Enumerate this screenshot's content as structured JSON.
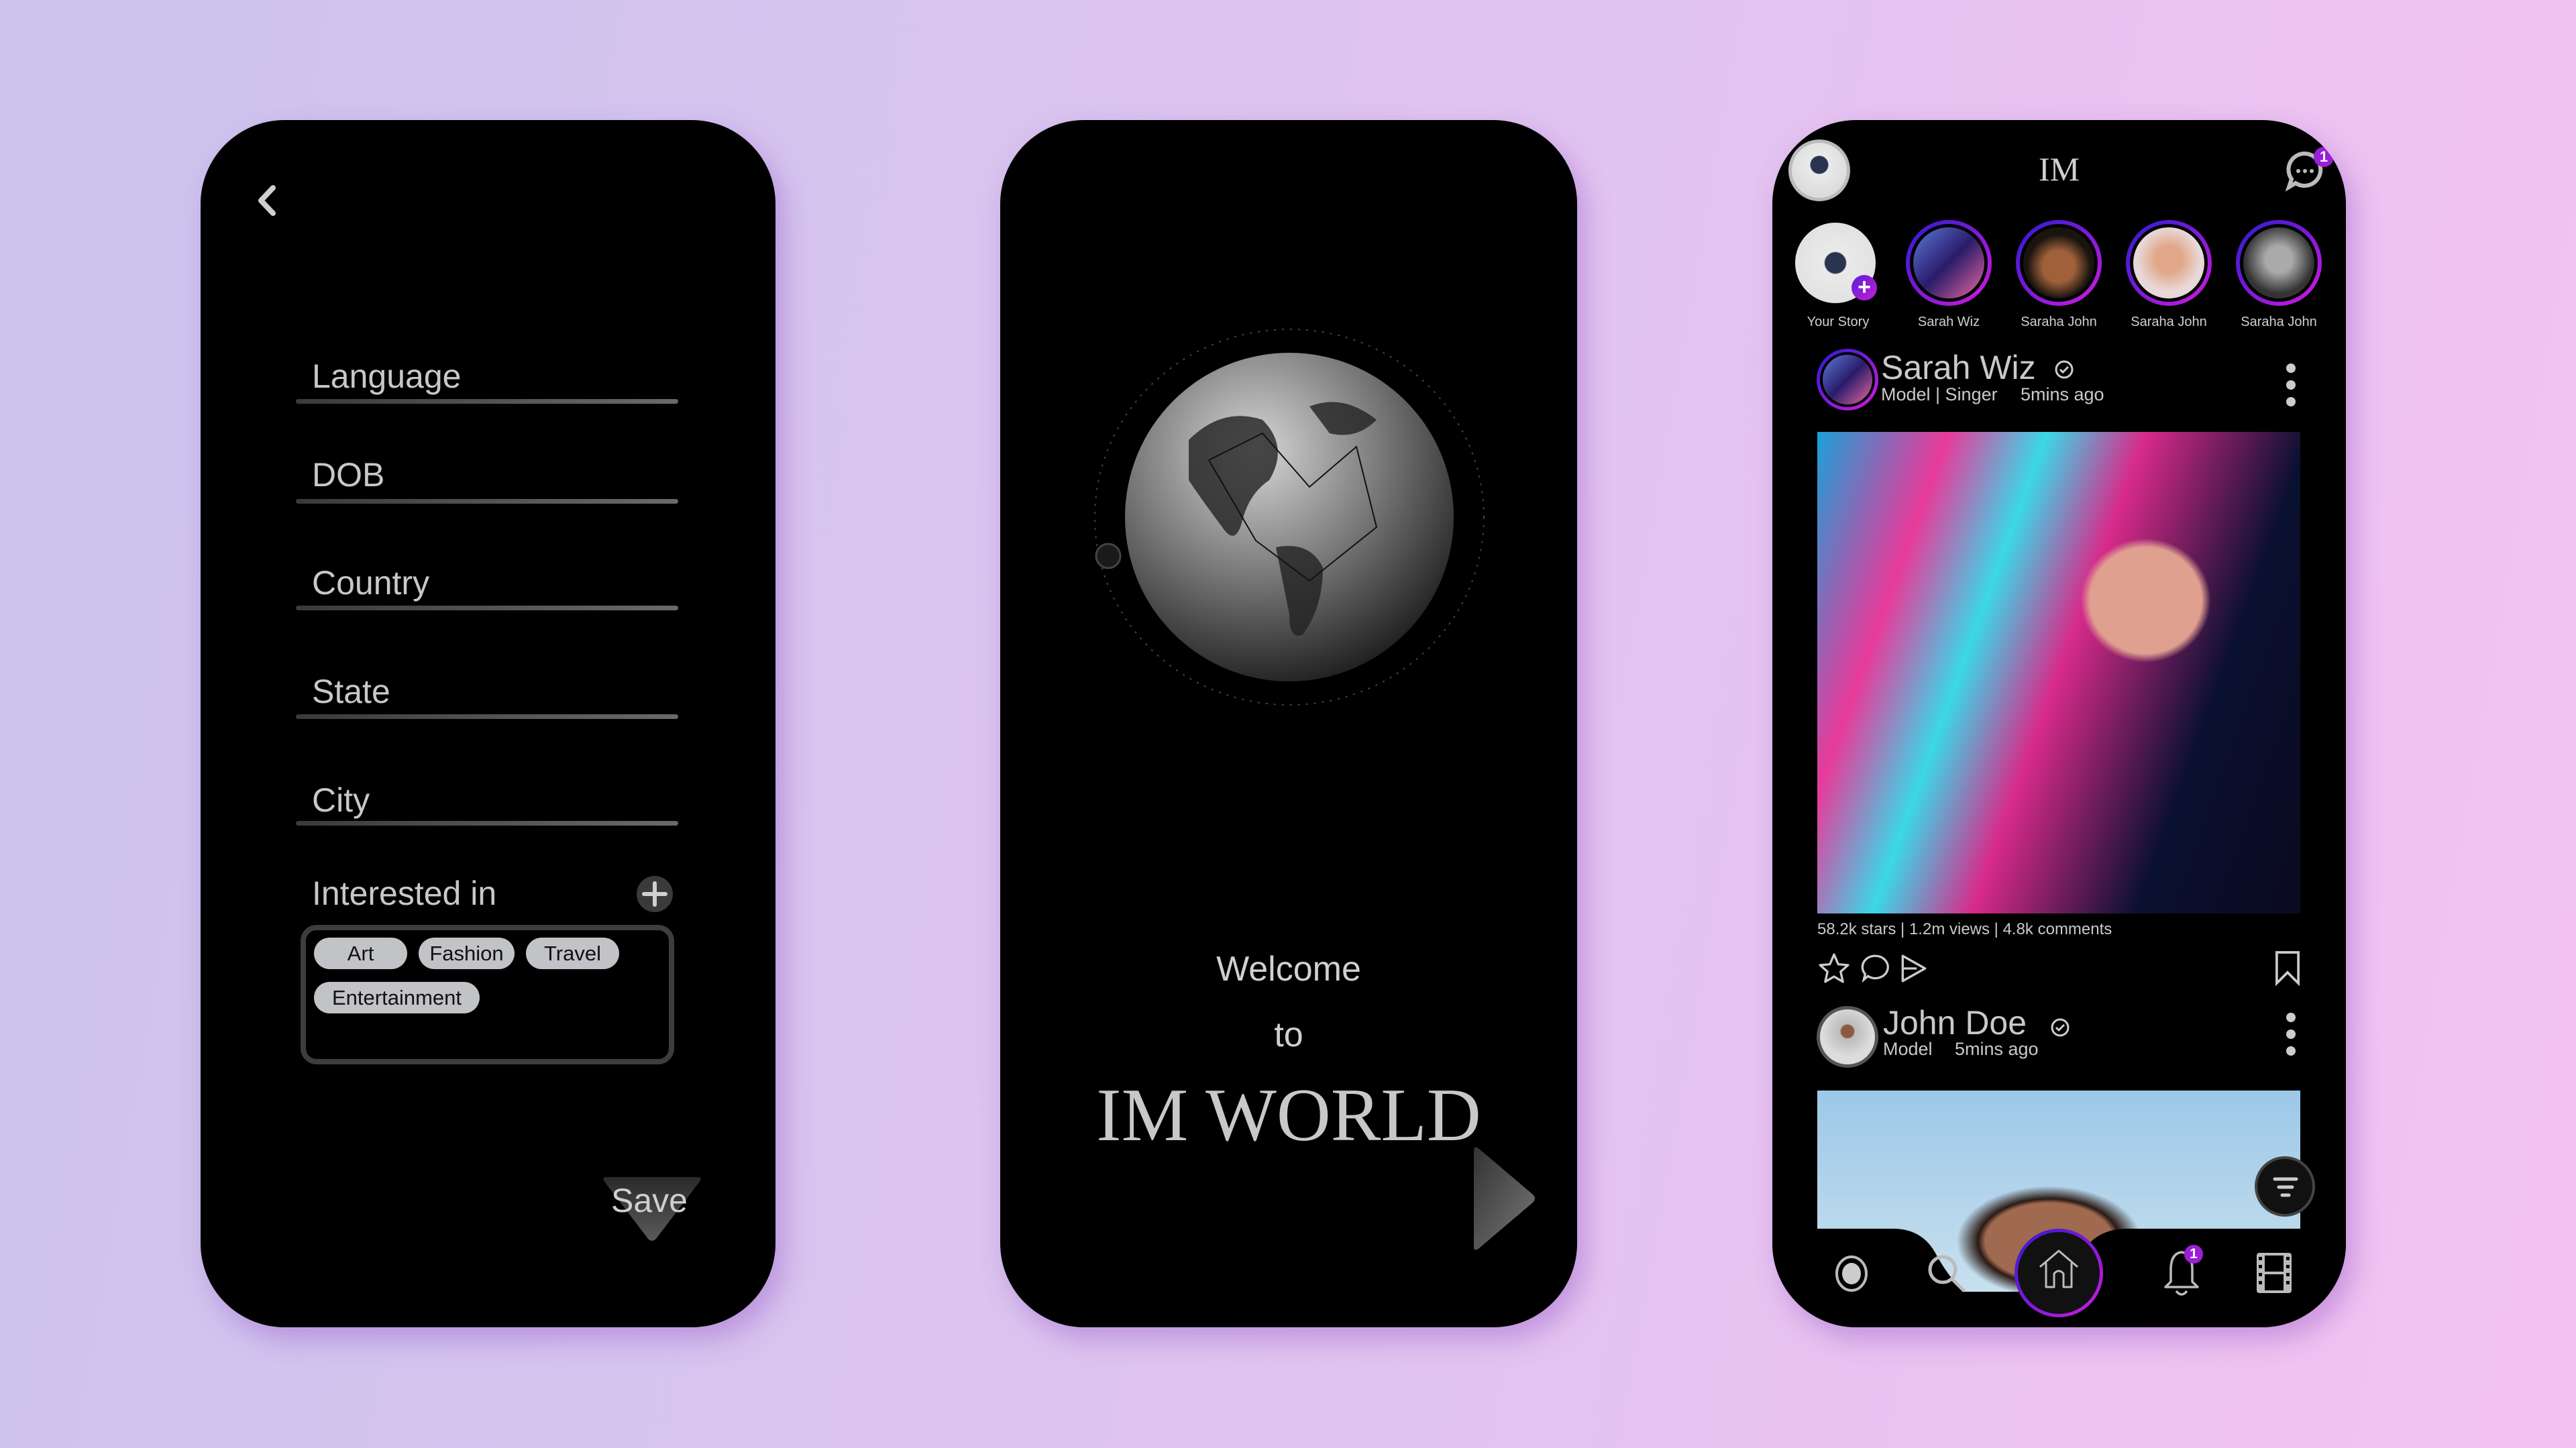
{
  "profile_form": {
    "back_icon": "chevron-left-icon",
    "fields": [
      {
        "label": "Language"
      },
      {
        "label": "DOB"
      },
      {
        "label": "Country"
      },
      {
        "label": "State"
      },
      {
        "label": "City"
      }
    ],
    "interests_label": "Interested in",
    "add_icon": "plus-circle-icon",
    "interests": [
      "Art",
      "Fashion",
      "Travel",
      "Entertainment"
    ],
    "save_label": "Save"
  },
  "welcome": {
    "line1": "Welcome",
    "line2": "to",
    "title": "IM WORLD",
    "next_icon": "play-triangle-icon"
  },
  "feed": {
    "app_title": "IM",
    "message_badge": "1",
    "notification_badge": "1",
    "accent_gradient": [
      "#2a1bd0",
      "#d21bdd"
    ],
    "stories": [
      {
        "label": "Your Story"
      },
      {
        "label": "Sarah Wiz"
      },
      {
        "label": "Saraha John"
      },
      {
        "label": "Saraha John"
      },
      {
        "label": "Saraha John"
      }
    ],
    "posts": [
      {
        "name": "Sarah Wiz",
        "subtitle": "Model | Singer",
        "time": "5mins ago",
        "stats": "58.2k stars | 1.2m views | 4.8k comments"
      },
      {
        "name": "John Doe",
        "subtitle": "Model",
        "time": "5mins ago"
      }
    ],
    "nav": [
      "record-icon",
      "search-icon",
      "home-icon",
      "bell-icon",
      "film-icon"
    ]
  }
}
